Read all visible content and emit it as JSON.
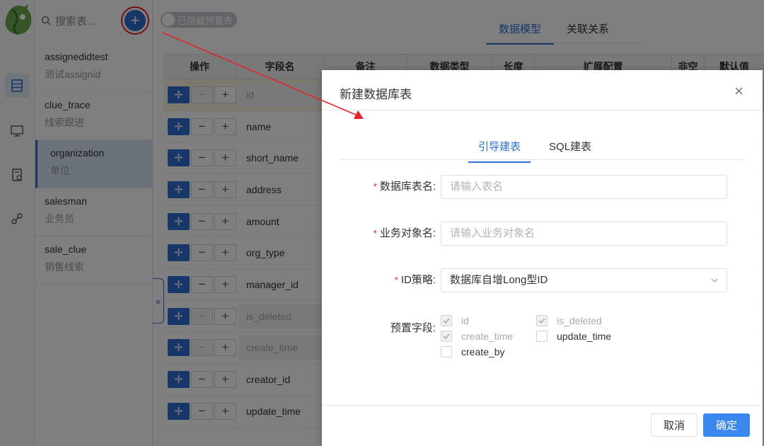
{
  "sidebar": {
    "search_placeholder": "搜索表...",
    "tables": [
      {
        "name": "assignedidtest",
        "label": "测试assignid"
      },
      {
        "name": "clue_trace",
        "label": "线索跟进"
      },
      {
        "name": "organization",
        "label": "单位",
        "selected": true
      },
      {
        "name": "salesman",
        "label": "业务员"
      },
      {
        "name": "sale_clue",
        "label": "销售线索"
      }
    ],
    "collapse_glyph": "«"
  },
  "toolbar": {
    "toggle_label": "已隐藏预置表"
  },
  "main_tabs": [
    {
      "label": "数据模型",
      "active": true
    },
    {
      "label": "关联关系",
      "active": false
    }
  ],
  "grid": {
    "headers": [
      "操作",
      "字段名",
      "备注",
      "数据类型",
      "长度",
      "扩展配置",
      "非空",
      "默认值"
    ],
    "rows": [
      {
        "field": "id",
        "disabled": true,
        "highlight": true
      },
      {
        "field": "name",
        "disabled": false
      },
      {
        "field": "short_name",
        "disabled": false
      },
      {
        "field": "address",
        "disabled": false
      },
      {
        "field": "amount",
        "disabled": false
      },
      {
        "field": "org_type",
        "disabled": false
      },
      {
        "field": "manager_id",
        "disabled": false
      },
      {
        "field": "is_deleted",
        "disabled": true
      },
      {
        "field": "create_time",
        "disabled": true
      },
      {
        "field": "creator_id",
        "disabled": false
      },
      {
        "field": "update_time",
        "disabled": false
      }
    ]
  },
  "dialog": {
    "title": "新建数据库表",
    "close_glyph": "×",
    "tabs": [
      {
        "label": "引导建表",
        "active": true
      },
      {
        "label": "SQL建表",
        "active": false
      }
    ],
    "fields": {
      "table_name": {
        "label": "数据库表名:",
        "placeholder": "请输入表名",
        "required": true
      },
      "biz_name": {
        "label": "业务对象名:",
        "placeholder": "请输入业务对象名",
        "required": true
      },
      "id_strategy": {
        "label": "ID策略:",
        "value": "数据库自增Long型ID",
        "required": true
      }
    },
    "preset_label": "预置字段:",
    "preset_fields": [
      {
        "name": "id",
        "checked": true,
        "disabled": true
      },
      {
        "name": "is_deleted",
        "checked": true,
        "disabled": true
      },
      {
        "name": "create_time",
        "checked": true,
        "disabled": true
      },
      {
        "name": "update_time",
        "checked": false,
        "disabled": false
      },
      {
        "name": "create_by",
        "checked": false,
        "disabled": false
      }
    ],
    "cancel_label": "取消",
    "ok_label": "确定"
  },
  "colors": {
    "primary": "#2f6fd1",
    "ok_button": "#3a87f0",
    "annotation_red": "#e8212a"
  }
}
